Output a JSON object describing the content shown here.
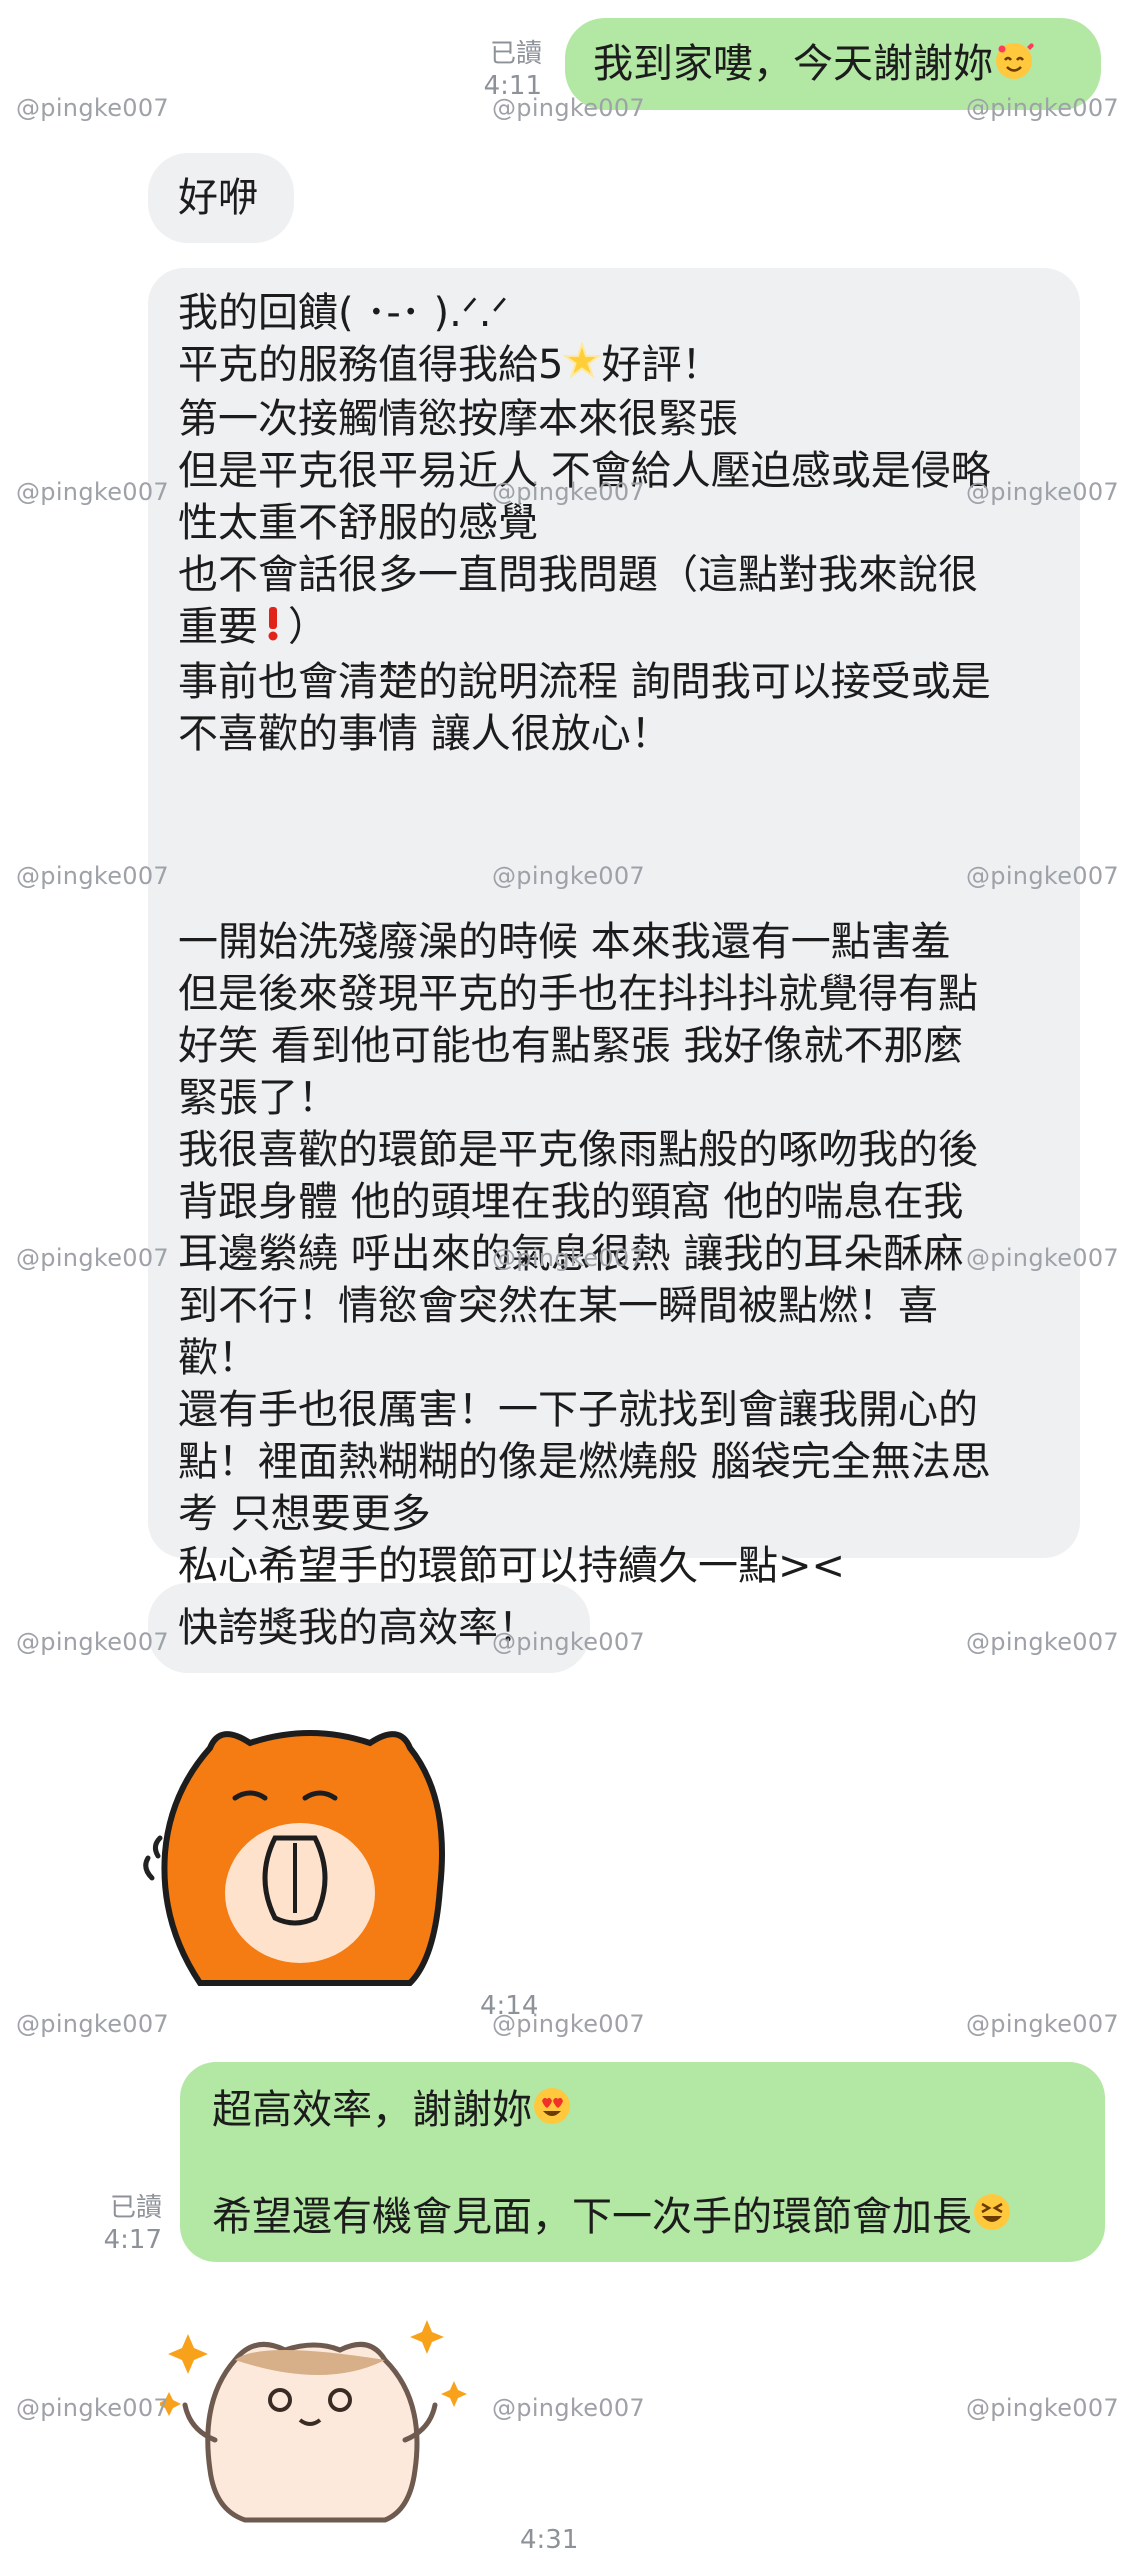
{
  "colors": {
    "outgoing_bubble": "#b3e7a4",
    "incoming_bubble": "#eef0f2",
    "meta_text": "#8d9299",
    "watermark": "#9ea2a8"
  },
  "watermark": "@pingke007",
  "messages": {
    "m1": {
      "text": "我到家嘍，今天謝謝妳",
      "emoji": "smiling-face-with-hearts-icon",
      "read": "已讀",
      "time": "4:11"
    },
    "m2": {
      "text": "好咿"
    },
    "m3": {
      "lines": [
        "我的回饋(  ･-･ ).ᐟ.ᐟ",
        "平克的服務值得我給5",
        "第一次接觸情慾按摩本來很緊張",
        "但是平克很平易近人 不會給人壓迫感或是侵略",
        "性太重不舒服的感覺",
        "也不會話很多一直問我問題（這點對我來說很",
        "重要",
        "事前也會清楚的說明流程 詢問我可以接受或是",
        "不喜歡的事情 讓人很放心！",
        "一開始洗殘廢澡的時候 本來我還有一點害羞",
        "但是後來發現平克的手也在抖抖抖就覺得有點",
        "好笑 看到他可能也有點緊張 我好像就不那麼",
        "緊張了！",
        "我很喜歡的環節是平克像雨點般的啄吻我的後",
        "背跟身體 他的頭埋在我的頸窩 他的喘息在我",
        "耳邊縈繞 呼出來的氣息很熱 讓我的耳朵酥麻",
        "到不行！情慾會突然在某一瞬間被點燃！喜",
        "歡！",
        "還有手也很厲害！一下子就找到會讓我開心的",
        "點！裡面熱糊糊的像是燃燒般 腦袋完全無法思",
        "考 只想要更多",
        "私心希望手的環節可以持續久一點><"
      ],
      "line2_suffix": "好評！",
      "line7_suffix": "）"
    },
    "m4": {
      "text": "快誇獎我的高效率！"
    },
    "m5": {
      "sticker": "hamster-praying-sticker",
      "time": "4:14"
    },
    "m6": {
      "line1": "超高效率，謝謝妳",
      "line2": "希望還有機會見面，下一次手的環節會加長",
      "read": "已讀",
      "time": "4:17"
    },
    "m7": {
      "sticker": "hamster-cheering-sticker",
      "time": "4:31"
    }
  }
}
